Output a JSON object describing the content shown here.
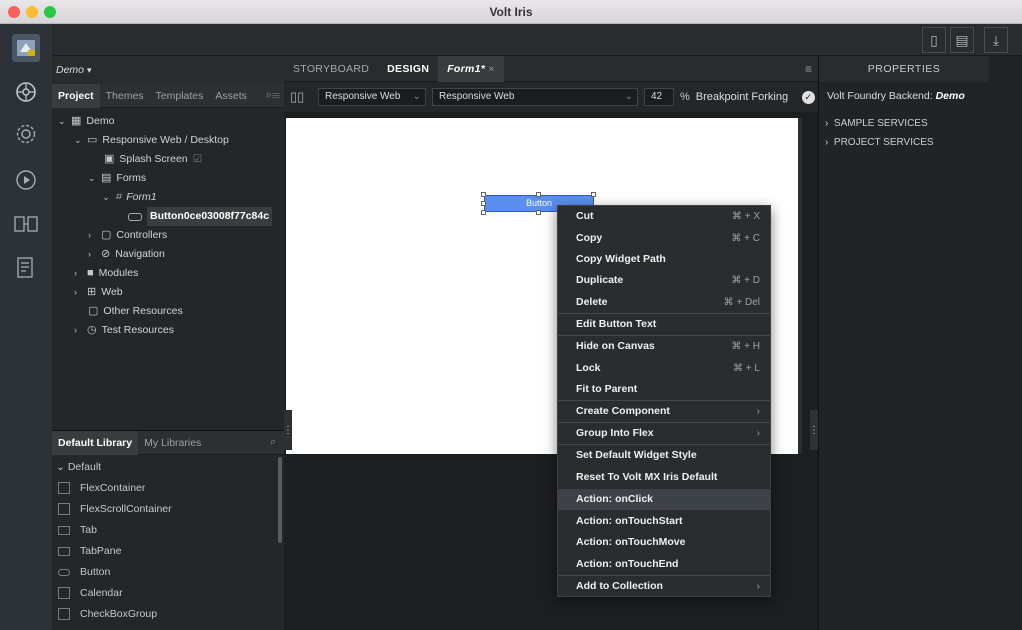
{
  "window": {
    "title": "Volt Iris"
  },
  "project": {
    "name": "Demo",
    "tabs": [
      "Project",
      "Themes",
      "Templates",
      "Assets"
    ],
    "tree": [
      {
        "label": "Demo",
        "icon": "grid-icon"
      },
      {
        "label": "Responsive Web / Desktop",
        "icon": "monitor-icon"
      },
      {
        "label": "Splash Screen",
        "icon": "splash-icon"
      },
      {
        "label": "Forms",
        "icon": "forms-icon"
      },
      {
        "label": "Form1",
        "icon": "form-icon"
      },
      {
        "label": "Button0ce03008f77c84c",
        "icon": "button-widget-icon"
      },
      {
        "label": "Controllers",
        "icon": "folder-icon"
      },
      {
        "label": "Navigation",
        "icon": "navigation-icon"
      },
      {
        "label": "Modules",
        "icon": "modules-icon"
      },
      {
        "label": "Web",
        "icon": "web-icon"
      },
      {
        "label": "Other Resources",
        "icon": "folder-icon"
      },
      {
        "label": "Test Resources",
        "icon": "test-icon"
      }
    ]
  },
  "library": {
    "tabs": [
      "Default Library",
      "My Libraries"
    ],
    "group": "Default",
    "items": [
      "FlexContainer",
      "FlexScrollContainer",
      "Tab",
      "TabPane",
      "Button",
      "Calendar",
      "CheckBoxGroup"
    ]
  },
  "center": {
    "tabs": [
      "STORYBOARD",
      "DESIGN",
      "Form1*"
    ],
    "close_glyph": "×",
    "toolbar": {
      "platform": "Responsive Web",
      "channel": "Responsive Web",
      "zoom": "42",
      "zoom_unit": "%",
      "breakpoint": "Breakpoint Forking"
    },
    "widget_label": "Button"
  },
  "properties": {
    "title": "PROPERTIES",
    "backend_label": "Volt Foundry Backend:",
    "backend_value": "Demo",
    "sections": [
      "SAMPLE SERVICES",
      "PROJECT SERVICES"
    ]
  },
  "context_menu": {
    "items": [
      {
        "label": "Cut",
        "shortcut": "⌘ + X"
      },
      {
        "label": "Copy",
        "shortcut": "⌘ + C"
      },
      {
        "label": "Copy Widget Path",
        "shortcut": ""
      },
      {
        "label": "Duplicate",
        "shortcut": "⌘ + D"
      },
      {
        "label": "Delete",
        "shortcut": "⌘ + Del"
      },
      {
        "label": "Edit Button Text",
        "shortcut": ""
      },
      {
        "label": "Hide on Canvas",
        "shortcut": "⌘ + H"
      },
      {
        "label": "Lock",
        "shortcut": "⌘ + L"
      },
      {
        "label": "Fit to Parent",
        "shortcut": ""
      },
      {
        "label": "Create Component",
        "shortcut": "›"
      },
      {
        "label": "Group Into Flex",
        "shortcut": "›"
      },
      {
        "label": "Set Default Widget Style",
        "shortcut": ""
      },
      {
        "label": "Reset To Volt MX Iris Default",
        "shortcut": ""
      },
      {
        "label": "Action: onClick",
        "shortcut": ""
      },
      {
        "label": "Action: onTouchStart",
        "shortcut": ""
      },
      {
        "label": "Action: onTouchMove",
        "shortcut": ""
      },
      {
        "label": "Action: onTouchEnd",
        "shortcut": ""
      },
      {
        "label": "Add to Collection",
        "shortcut": "›"
      }
    ]
  }
}
